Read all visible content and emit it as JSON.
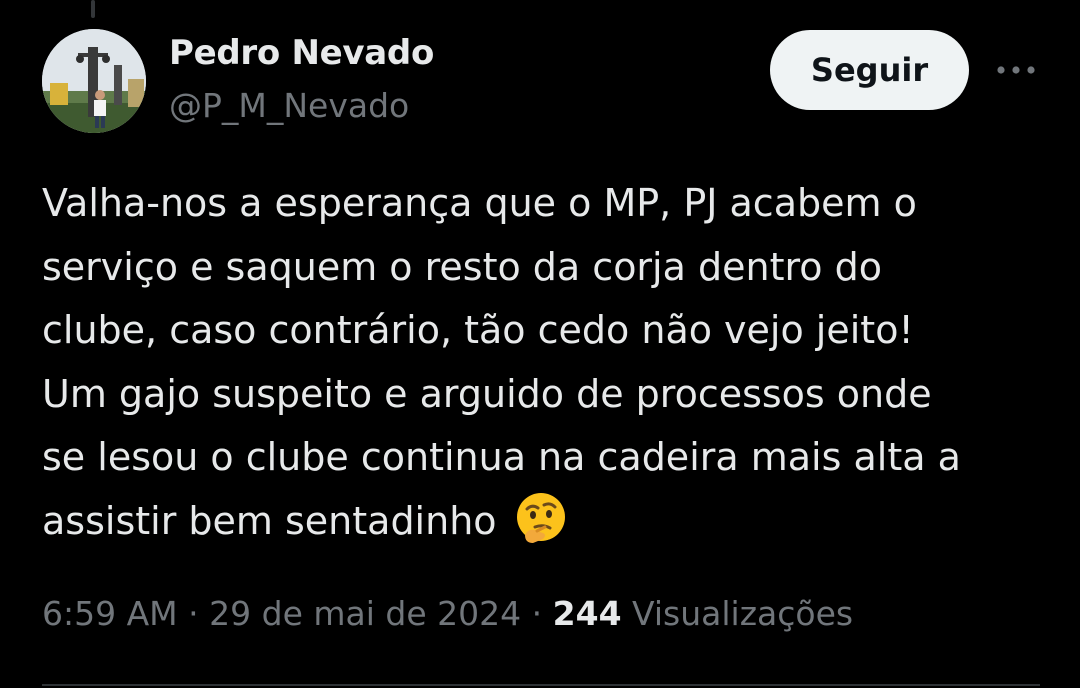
{
  "author": {
    "display_name": "Pedro Nevado",
    "handle": "@P_M_Nevado"
  },
  "actions": {
    "follow_label": "Seguir",
    "more_icon": "more-horizontal-icon"
  },
  "tweet": {
    "lines": [
      "Valha-nos a esperança que o MP, PJ acabem o",
      "serviço e saquem o resto da corja dentro do",
      "clube, caso contrário, tão cedo não vejo jeito!",
      "Um gajo suspeito e arguido de processos onde",
      "se lesou o clube continua na cadeira mais alta a",
      "assistir bem sentadinho"
    ],
    "emoji": "thinking-face-emoji"
  },
  "meta": {
    "time": "6:59 AM",
    "separator": "·",
    "date": "29 de mai de 2024",
    "views_count": "244",
    "views_label": "Visualizações"
  },
  "colors": {
    "background": "#000000",
    "text_primary": "#e7e9ea",
    "text_secondary": "#71767b",
    "button_bg": "#eff3f4",
    "divider": "#2f3336"
  }
}
